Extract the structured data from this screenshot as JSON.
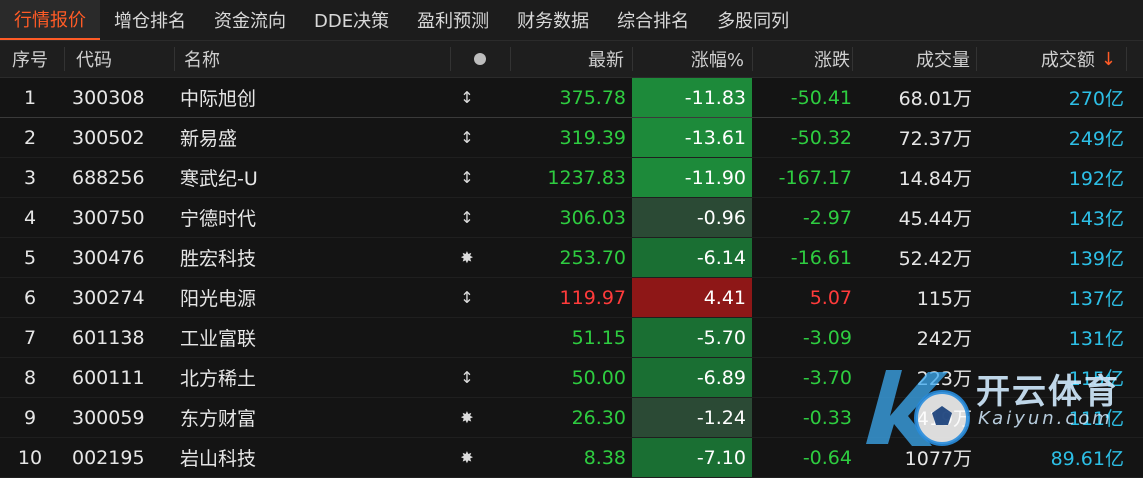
{
  "tabs": [
    {
      "label": "行情报价",
      "active": true
    },
    {
      "label": "增仓排名",
      "active": false
    },
    {
      "label": "资金流向",
      "active": false
    },
    {
      "label": "DDE决策",
      "active": false
    },
    {
      "label": "盈利预测",
      "active": false
    },
    {
      "label": "财务数据",
      "active": false
    },
    {
      "label": "综合排名",
      "active": false
    },
    {
      "label": "多股同列",
      "active": false
    }
  ],
  "header": {
    "seq": "序号",
    "code": "代码",
    "name": "名称",
    "last": "最新",
    "pct": "涨幅%",
    "chg": "涨跌",
    "vol": "成交量",
    "amt": "成交额"
  },
  "rows": [
    {
      "seq": "1",
      "code": "300308",
      "name": "中际旭创",
      "mark": "↕",
      "last": "375.78",
      "pct": "-11.83",
      "chg": "-50.41",
      "vol": "68.01万",
      "amt": "270亿"
    },
    {
      "seq": "2",
      "code": "300502",
      "name": "新易盛",
      "mark": "↕",
      "last": "319.39",
      "pct": "-13.61",
      "chg": "-50.32",
      "vol": "72.37万",
      "amt": "249亿"
    },
    {
      "seq": "3",
      "code": "688256",
      "name": "寒武纪-U",
      "mark": "↕",
      "last": "1237.83",
      "pct": "-11.90",
      "chg": "-167.17",
      "vol": "14.84万",
      "amt": "192亿"
    },
    {
      "seq": "4",
      "code": "300750",
      "name": "宁德时代",
      "mark": "↕",
      "last": "306.03",
      "pct": "-0.96",
      "chg": "-2.97",
      "vol": "45.44万",
      "amt": "143亿"
    },
    {
      "seq": "5",
      "code": "300476",
      "name": "胜宏科技",
      "mark": "✸",
      "last": "253.70",
      "pct": "-6.14",
      "chg": "-16.61",
      "vol": "52.42万",
      "amt": "139亿"
    },
    {
      "seq": "6",
      "code": "300274",
      "name": "阳光电源",
      "mark": "↕",
      "last": "119.97",
      "pct": "4.41",
      "chg": "5.07",
      "vol": "115万",
      "amt": "137亿"
    },
    {
      "seq": "7",
      "code": "601138",
      "name": "工业富联",
      "mark": "",
      "last": "51.15",
      "pct": "-5.70",
      "chg": "-3.09",
      "vol": "242万",
      "amt": "131亿"
    },
    {
      "seq": "8",
      "code": "600111",
      "name": "北方稀土",
      "mark": "↕",
      "last": "50.00",
      "pct": "-6.89",
      "chg": "-3.70",
      "vol": "223万",
      "amt": "115亿"
    },
    {
      "seq": "9",
      "code": "300059",
      "name": "东方财富",
      "mark": "✸",
      "last": "26.30",
      "pct": "-1.24",
      "chg": "-0.33",
      "vol": "419万",
      "amt": "111亿"
    },
    {
      "seq": "10",
      "code": "002195",
      "name": "岩山科技",
      "mark": "✸",
      "last": "8.38",
      "pct": "-7.10",
      "chg": "-0.64",
      "vol": "1077万",
      "amt": "89.61亿"
    }
  ],
  "watermark": {
    "cn": "开云体育",
    "en": "Kaiyun.com"
  },
  "colors": {
    "accent": "#ff5b26",
    "up": "#ff3b3b",
    "down": "#2ecc40",
    "amount": "#2dbfe6"
  }
}
